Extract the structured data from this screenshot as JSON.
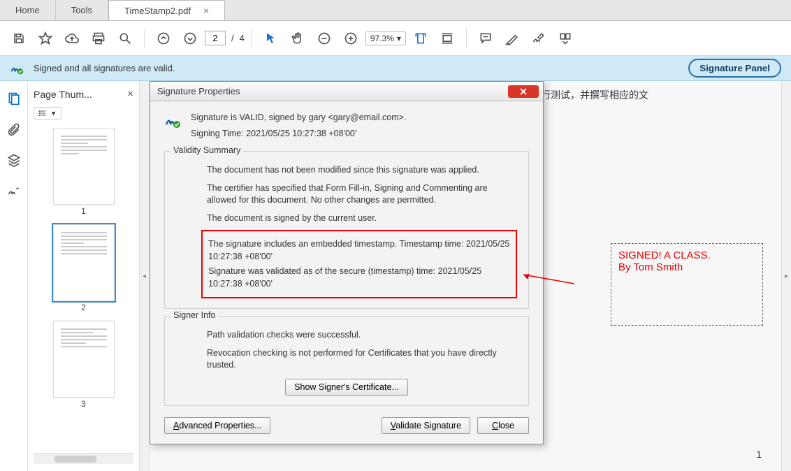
{
  "tabs": {
    "home": "Home",
    "tools": "Tools",
    "doc": "TimeStamp2.pdf"
  },
  "toolbar": {
    "page_current": "2",
    "page_sep": "/",
    "page_total": "4",
    "zoom": "97.3%"
  },
  "banner": {
    "msg": "Signed and all signatures are valid.",
    "button": "Signature Panel"
  },
  "thumbs": {
    "title": "Page Thum...",
    "nums": [
      "1",
      "2",
      "3"
    ]
  },
  "doc": {
    "header_text": "行测试，并撰写相应的文",
    "stamp_line1": "SIGNED! A CLASS.",
    "stamp_line2": " By Tom Smith",
    "page_number": "1"
  },
  "dialog": {
    "title": "Signature Properties",
    "valid_line": "Signature is VALID, signed by gary <gary@email.com>.",
    "signing_time": "Signing Time:  2021/05/25 10:27:38 +08'00'",
    "validity_legend": "Validity Summary",
    "v1": "The document has not been modified since this signature was applied.",
    "v2": "The certifier has specified that Form Fill-in, Signing and Commenting are allowed for this document. No other changes are permitted.",
    "v3": "The document is signed by the current user.",
    "ts1": "The signature includes an embedded timestamp. Timestamp time: 2021/05/25 10:27:38 +08'00'",
    "ts2": "Signature was validated as of the secure (timestamp) time: 2021/05/25 10:27:38 +08'00'",
    "signer_legend": "Signer Info",
    "s1": "Path validation checks were successful.",
    "s2": "Revocation checking is not performed for Certificates that you have directly trusted.",
    "show_cert": "Show Signer's Certificate...",
    "adv_a": "A",
    "adv_rest": "dvanced Properties...",
    "val_v": "V",
    "val_rest": "alidate Signature",
    "close_c": "C",
    "close_rest": "lose"
  }
}
